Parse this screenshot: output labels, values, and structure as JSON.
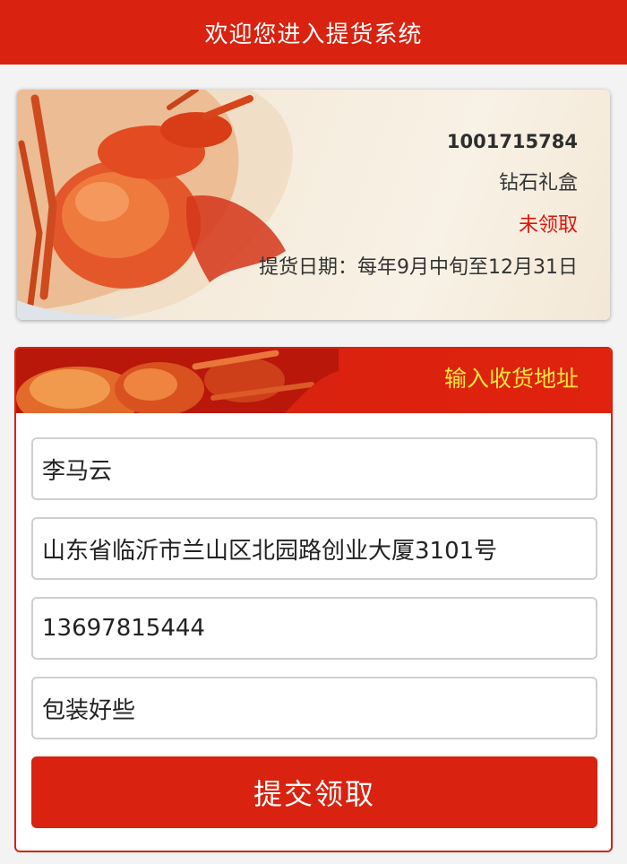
{
  "header": {
    "title": "欢迎您进入提货系统"
  },
  "card": {
    "code": "1001715784",
    "product": "钻石礼盒",
    "status": "未领取",
    "pickup_date": "提货日期：每年9月中旬至12月31日"
  },
  "form": {
    "title": "输入收货地址",
    "name_value": "李马云",
    "address_value": "山东省临沂市兰山区北园路创业大厦3101号",
    "phone_value": "13697815444",
    "note_value": "包装好些",
    "submit_label": "提交领取"
  },
  "colors": {
    "brand_red": "#d9220f",
    "status_red": "#e0140a",
    "header_title_yellow": "#ffe83a"
  }
}
